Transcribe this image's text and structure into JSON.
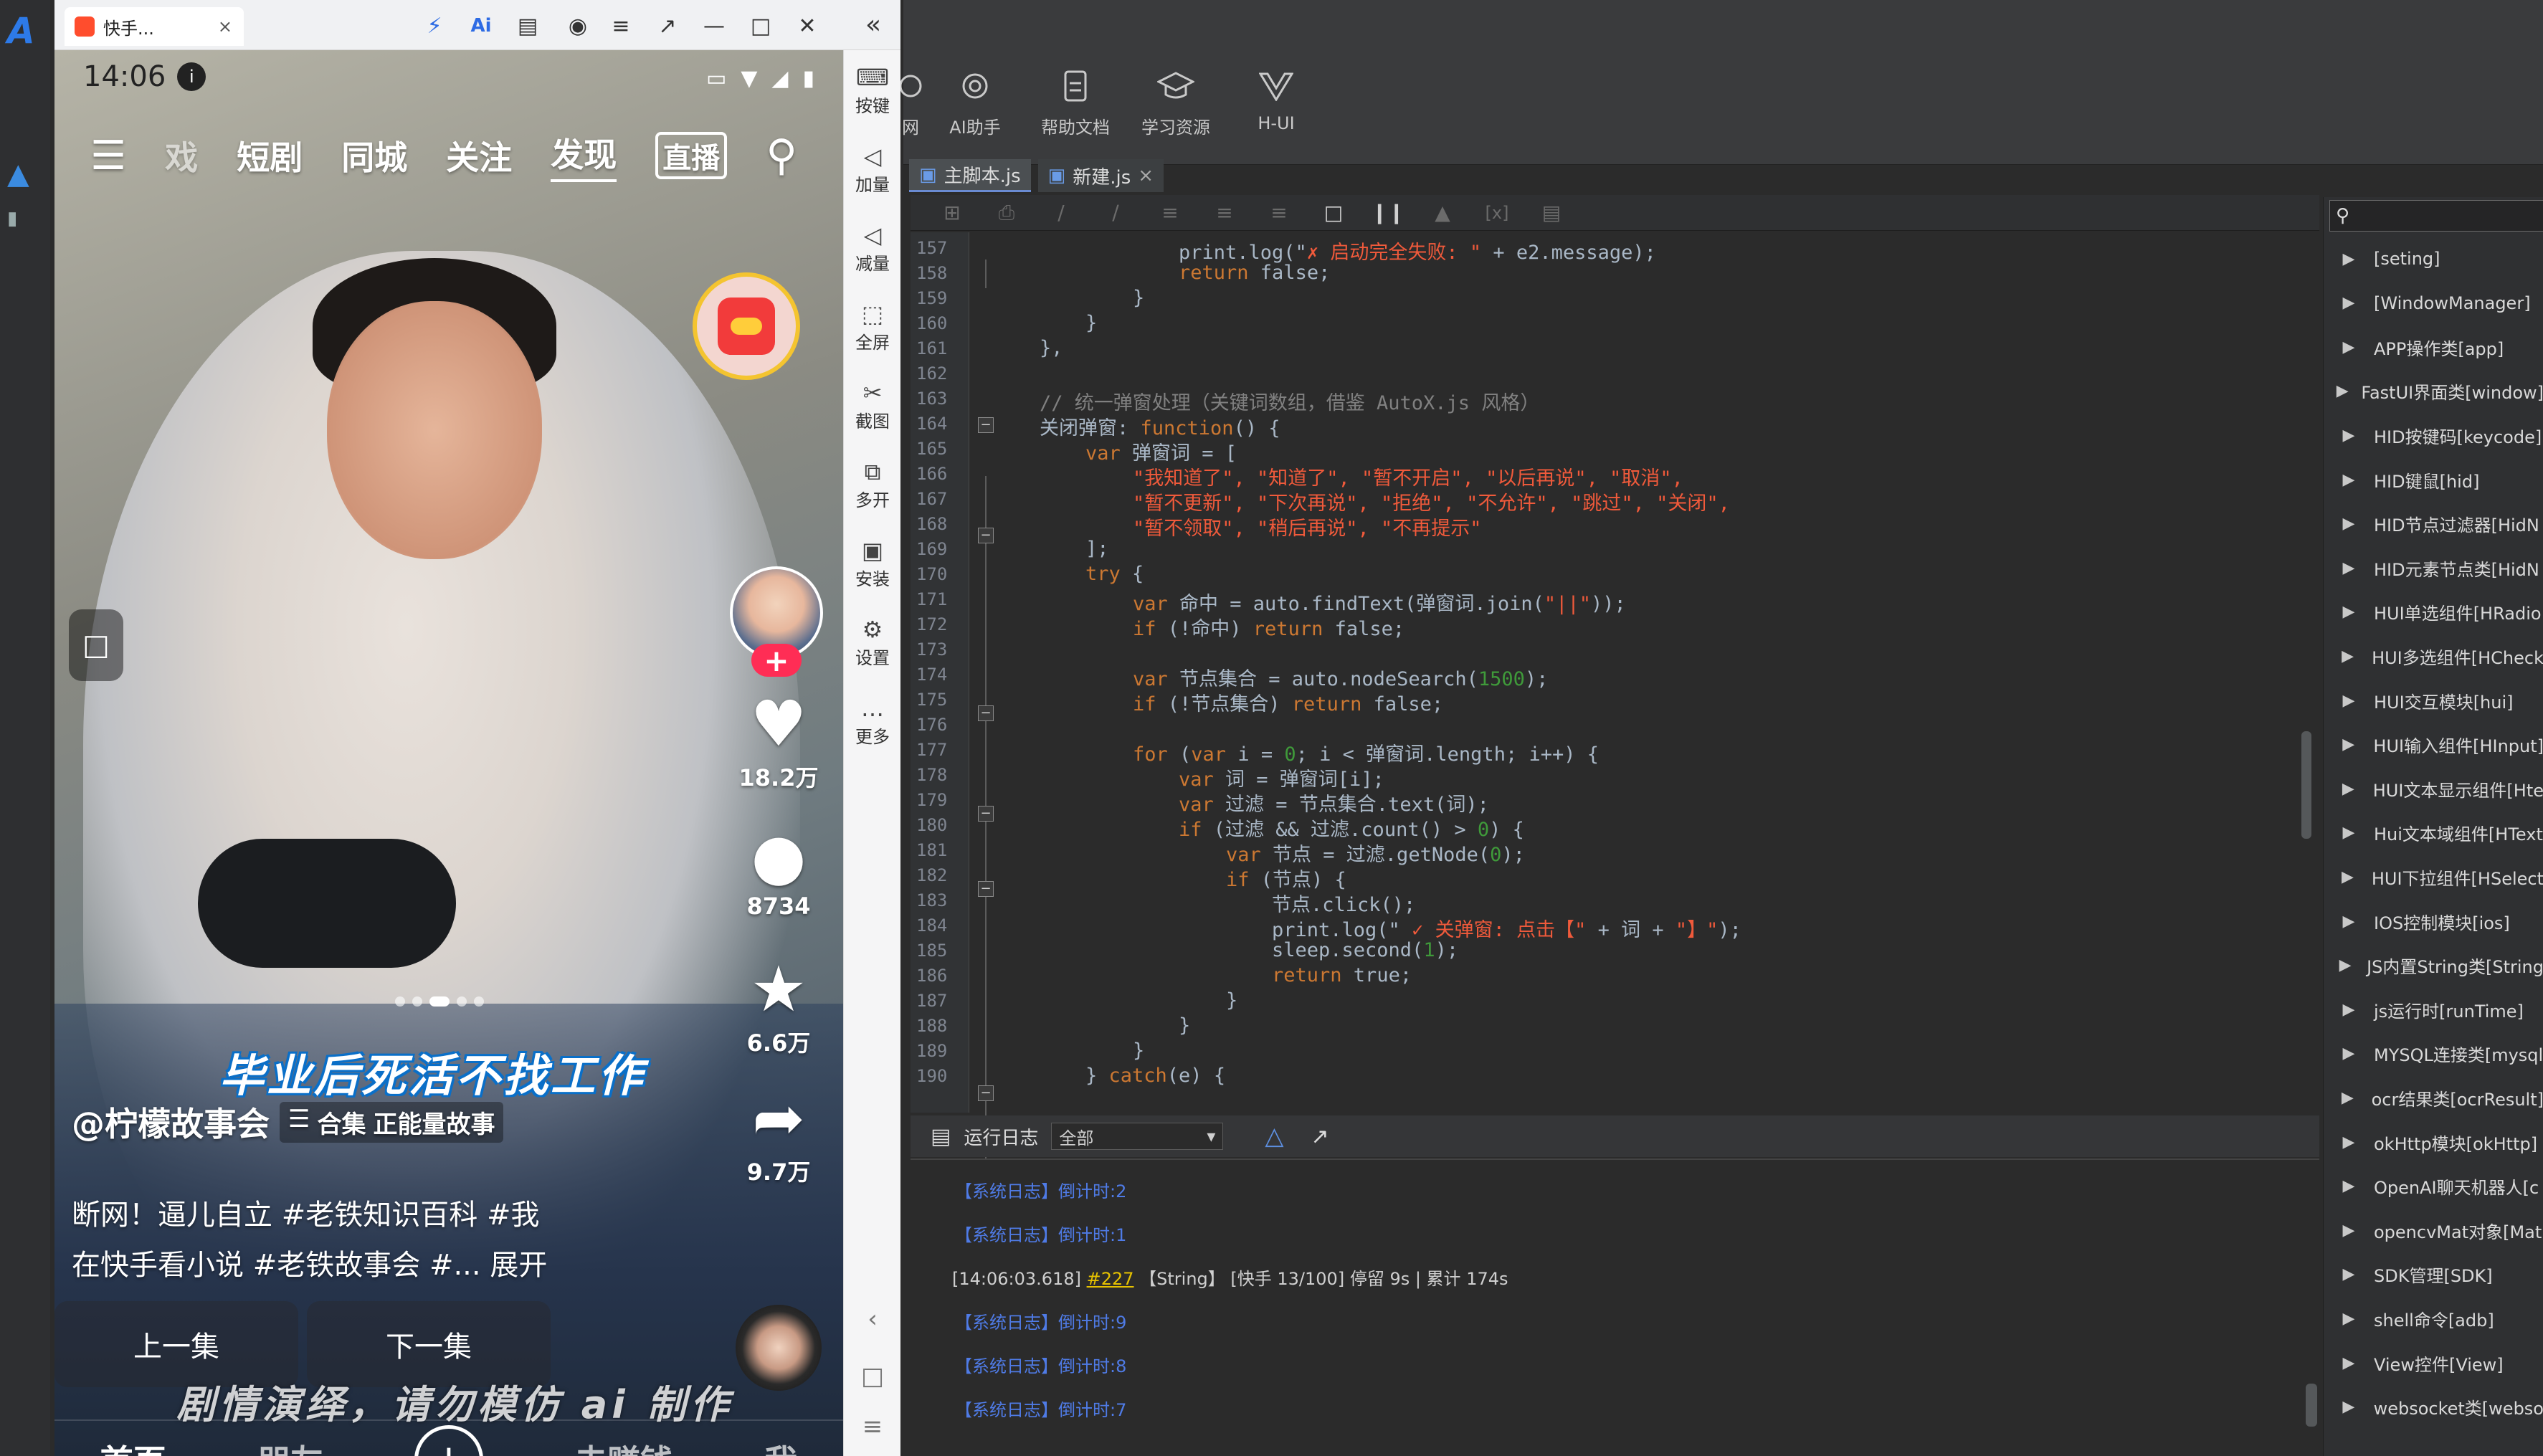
{
  "phone_window": {
    "tab_title": "快手...",
    "status_time": "14:06",
    "top_nav": [
      "戏",
      "短剧",
      "同城",
      "关注",
      "发现",
      "直播"
    ],
    "side_actions": {
      "likes": "18.2万",
      "comments": "8734",
      "favorites": "6.6万",
      "shares": "9.7万"
    },
    "overlay_title": "毕业后死活不找工作",
    "author": "@柠檬故事会",
    "collection_label": "合集",
    "collection_name": "正能量故事",
    "description_line1": "断网！逼儿自立 #老铁知识百科 #我",
    "description_line2": "在快手看小说 #老铁故事会 #... 展开",
    "prev_episode": "上一集",
    "next_episode": "下一集",
    "watermark": "剧情演绎，请勿模仿 ai 制作",
    "bottom_nav": {
      "home": "首页",
      "friends": "朋友",
      "earn": "去赚钱",
      "me": "我"
    }
  },
  "emulator_sidebar": [
    {
      "label": "按键",
      "icon": "keyboard-icon"
    },
    {
      "label": "加量",
      "icon": "volume-up-icon"
    },
    {
      "label": "减量",
      "icon": "volume-down-icon"
    },
    {
      "label": "全屏",
      "icon": "fullscreen-icon"
    },
    {
      "label": "截图",
      "icon": "scissors-icon"
    },
    {
      "label": "多开",
      "icon": "multi-window-icon"
    },
    {
      "label": "安装",
      "icon": "apk-icon"
    },
    {
      "label": "设置",
      "icon": "gear-icon"
    },
    {
      "label": "更多",
      "icon": "more-icon"
    }
  ],
  "ide": {
    "ribbon": [
      {
        "label": "网",
        "icon": "web-icon"
      },
      {
        "label": "AI助手",
        "icon": "ai-icon"
      },
      {
        "label": "帮助文档",
        "icon": "doc-icon"
      },
      {
        "label": "学习资源",
        "icon": "graduation-icon"
      },
      {
        "label": "H-UI",
        "icon": "vue-icon"
      }
    ],
    "tabs": [
      {
        "label": "主脚本.js"
      },
      {
        "label": "新建.js"
      }
    ],
    "code_lines": [
      {
        "n": "157"
      },
      {
        "n": "158"
      },
      {
        "n": "159"
      },
      {
        "n": "160"
      },
      {
        "n": "161"
      },
      {
        "n": "162"
      },
      {
        "n": "163"
      },
      {
        "n": "164"
      },
      {
        "n": "165"
      },
      {
        "n": "166"
      },
      {
        "n": "167"
      },
      {
        "n": "168"
      },
      {
        "n": "169"
      },
      {
        "n": "170"
      },
      {
        "n": "171"
      },
      {
        "n": "172"
      },
      {
        "n": "173"
      },
      {
        "n": "174"
      },
      {
        "n": "175"
      },
      {
        "n": "176"
      },
      {
        "n": "177"
      },
      {
        "n": "178"
      },
      {
        "n": "179"
      },
      {
        "n": "180"
      },
      {
        "n": "181"
      },
      {
        "n": "182"
      },
      {
        "n": "183"
      },
      {
        "n": "184"
      },
      {
        "n": "185"
      },
      {
        "n": "186"
      },
      {
        "n": "187"
      },
      {
        "n": "188"
      },
      {
        "n": "189"
      },
      {
        "n": "190"
      }
    ],
    "code": {
      "l157a": "print.log(\"",
      "l157b": "✗ 启动完全失败: \"",
      "l157c": " + e2.message);",
      "l158a": "return",
      "l158b": " false;",
      "l159": "}",
      "l160": "}",
      "l161": "},",
      "l163": "// 统一弹窗处理（关键词数组，借鉴 AutoX.js 风格）",
      "l164a": "关闭弹窗: ",
      "l164b": "function",
      "l164c": "() {",
      "l165a": "var",
      "l165b": " 弹窗词 = [",
      "l166": "\"我知道了\", \"知道了\", \"暂不开启\", \"以后再说\", \"取消\",",
      "l167": "\"暂不更新\", \"下次再说\", \"拒绝\", \"不允许\", \"跳过\", \"关闭\",",
      "l168": "\"暂不领取\", \"稍后再说\", \"不再提示\"",
      "l169": "];",
      "l170a": "try",
      "l170b": " {",
      "l171a": "var",
      "l171b": " 命中 = auto.findText(弹窗词.join(",
      "l171c": "\"||\"",
      "l171d": "));",
      "l172a": "if",
      "l172b": " (!命中) ",
      "l172c": "return",
      "l172d": " false;",
      "l174a": "var",
      "l174b": " 节点集合 = auto.nodeSearch(",
      "l174c": "1500",
      "l174d": ");",
      "l175a": "if",
      "l175b": " (!节点集合) ",
      "l175c": "return",
      "l175d": " false;",
      "l177a": "for",
      "l177b": " (",
      "l177c": "var",
      "l177d": " i = ",
      "l177e": "0",
      "l177f": "; i < 弹窗词.length; i++) {",
      "l178a": "var",
      "l178b": " 词 = 弹窗词[i];",
      "l179a": "var",
      "l179b": " 过滤 = 节点集合.text(词);",
      "l180a": "if",
      "l180b": " (过滤 && 过滤.count() > ",
      "l180c": "0",
      "l180d": ") {",
      "l181a": "var",
      "l181b": " 节点 = 过滤.getNode(",
      "l181c": "0",
      "l181d": ");",
      "l182a": "if",
      "l182b": " (节点) {",
      "l183": "节点.click();",
      "l184a": "print.log(\"",
      "l184b": " ✓ 关弹窗: 点击【\"",
      "l184c": " + 词 + ",
      "l184d": "\"】\"",
      "l184e": ");",
      "l185a": "sleep.second(",
      "l185b": "1",
      "l185c": ");",
      "l186a": "return",
      "l186b": " true;",
      "l187": "}",
      "l188": "}",
      "l189": "}",
      "l190a": "} ",
      "l190b": "catch",
      "l190c": "(e) {"
    },
    "log_panel": {
      "title": "运行日志",
      "filter": "全部",
      "lines": [
        {
          "text": "【系统日志】倒计时:2"
        },
        {
          "text": "【系统日志】倒计时:1"
        },
        {
          "pre": "[14:06:03.618] ",
          "num": "#227",
          "post": " 【String】 [快手 13/100] 停留 9s | 累计 174s"
        },
        {
          "text": "【系统日志】倒计时:9"
        },
        {
          "text": "【系统日志】倒计时:8"
        },
        {
          "text": "【系统日志】倒计时:7"
        }
      ]
    },
    "api_tree": [
      "[seting]",
      "[WindowManager]",
      "APP操作类[app]",
      "FastUI界面类[window]",
      "HID按键码[keycode]",
      "HID键鼠[hid]",
      "HID节点过滤器[HidN",
      "HID元素节点类[HidN",
      "HUI单选组件[HRadio",
      "HUI多选组件[HCheck",
      "HUI交互模块[hui]",
      "HUI输入组件[HInput]",
      "HUI文本显示组件[Hte",
      "Hui文本域组件[HText",
      "HUI下拉组件[HSelect",
      "IOS控制模块[ios]",
      "JS内置String类[String",
      "js运行时[runTime]",
      "MYSQL连接类[mysql",
      "ocr结果类[ocrResult]",
      "okHttp模块[okHttp]",
      "OpenAI聊天机器人[c",
      "opencvMat对象[Mat",
      "SDK管理[SDK]",
      "shell命令[adb]",
      "View控件[View]",
      "websocket类[webso"
    ]
  }
}
